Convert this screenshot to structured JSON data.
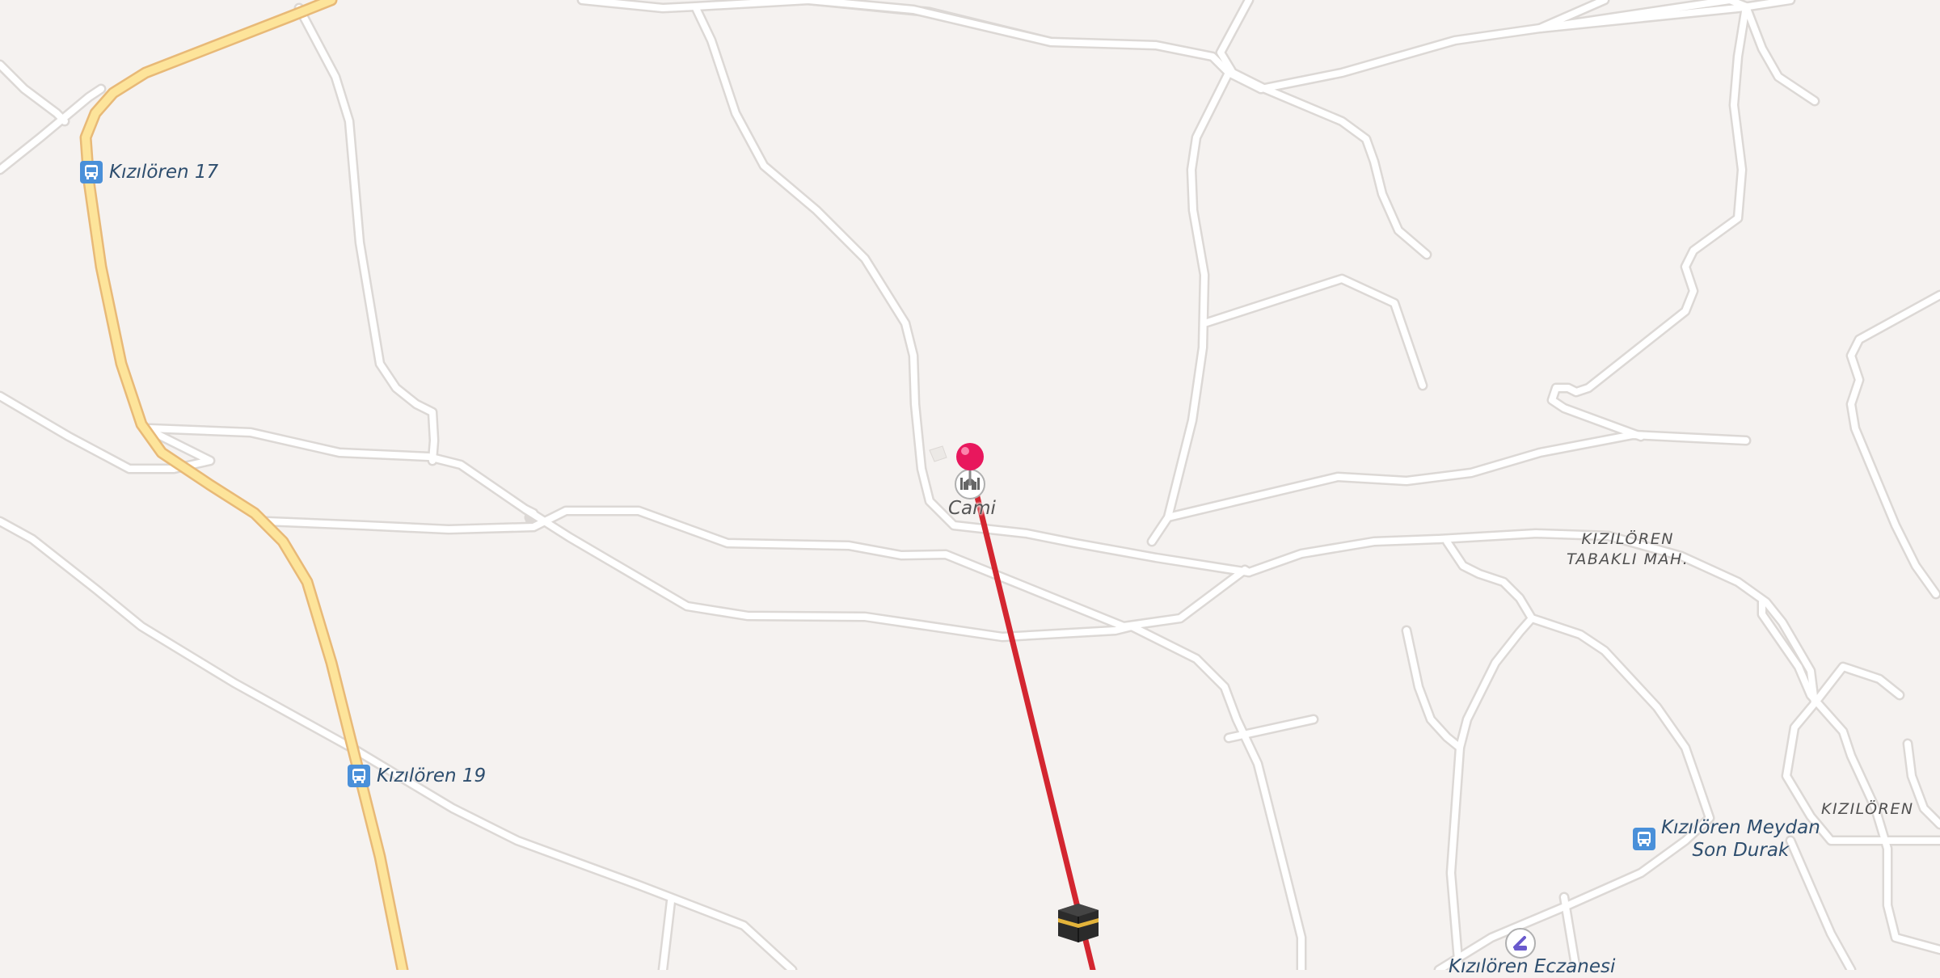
{
  "map": {
    "colors": {
      "background": "#f5f2f0",
      "road": "#ffffff",
      "road_casing": "#dcd8d5",
      "highway": "#fde49a",
      "highway_casing": "#e8b977",
      "route_line": "#d32630",
      "pin": "#e8175d",
      "bus_stop": "#4a90d9"
    },
    "bus_stops": [
      {
        "label": "Kızılören 17",
        "icon": "bus-stop-icon"
      },
      {
        "label": "Kızılören 19",
        "icon": "bus-stop-icon"
      },
      {
        "label_line1": "Kızılören Meydan",
        "label_line2": "Son Durak",
        "icon": "bus-stop-icon"
      }
    ],
    "poi": {
      "mosque_label": "Cami",
      "mosque_icon": "mosque-icon",
      "pharmacy_label": "Kızılören Eczanesi",
      "pharmacy_icon": "pharmacy-icon"
    },
    "areas": {
      "tabakli_line1": "KIZILÖREN",
      "tabakli_line2": "TABAKLI MAH.",
      "kizioren": "KIZILÖREN"
    },
    "markers": {
      "location_pin": "location-pin-icon",
      "qibla_target": "kaaba-icon"
    }
  }
}
